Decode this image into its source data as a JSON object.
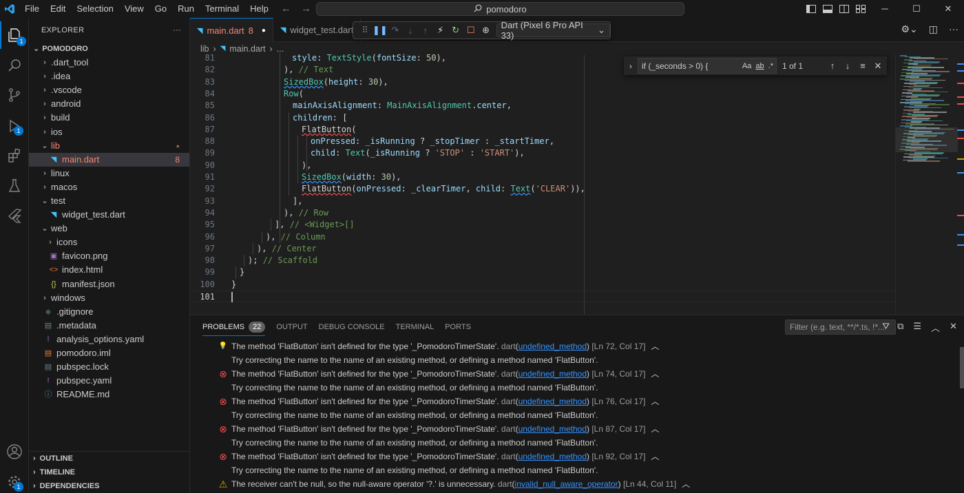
{
  "titlebar": {
    "menu": [
      "File",
      "Edit",
      "Selection",
      "View",
      "Go",
      "Run",
      "Terminal",
      "Help"
    ],
    "search": "pomodoro"
  },
  "activity": {
    "explorer_badge": "1",
    "debug_badge": "1",
    "settings_badge": "1"
  },
  "sidebar": {
    "title": "EXPLORER",
    "root": "POMODORO",
    "items": [
      {
        "label": ".dart_tool",
        "indent": 0,
        "kind": "folder",
        "open": false
      },
      {
        "label": ".idea",
        "indent": 0,
        "kind": "folder",
        "open": false
      },
      {
        "label": ".vscode",
        "indent": 0,
        "kind": "folder",
        "open": false
      },
      {
        "label": "android",
        "indent": 0,
        "kind": "folder",
        "open": false
      },
      {
        "label": "build",
        "indent": 0,
        "kind": "folder",
        "open": false
      },
      {
        "label": "ios",
        "indent": 0,
        "kind": "folder",
        "open": false
      },
      {
        "label": "lib",
        "indent": 0,
        "kind": "folder",
        "open": true,
        "error": true,
        "right": "●"
      },
      {
        "label": "main.dart",
        "indent": 1,
        "kind": "dart",
        "error": true,
        "selected": true,
        "right": "8"
      },
      {
        "label": "linux",
        "indent": 0,
        "kind": "folder",
        "open": false
      },
      {
        "label": "macos",
        "indent": 0,
        "kind": "folder",
        "open": false
      },
      {
        "label": "test",
        "indent": 0,
        "kind": "folder",
        "open": true
      },
      {
        "label": "widget_test.dart",
        "indent": 1,
        "kind": "dart"
      },
      {
        "label": "web",
        "indent": 0,
        "kind": "folder",
        "open": true
      },
      {
        "label": "icons",
        "indent": 1,
        "kind": "folder",
        "open": false
      },
      {
        "label": "favicon.png",
        "indent": 1,
        "kind": "image"
      },
      {
        "label": "index.html",
        "indent": 1,
        "kind": "html"
      },
      {
        "label": "manifest.json",
        "indent": 1,
        "kind": "json"
      },
      {
        "label": "windows",
        "indent": 0,
        "kind": "folder",
        "open": false
      },
      {
        "label": ".gitignore",
        "indent": 0,
        "kind": "git"
      },
      {
        "label": ".metadata",
        "indent": 0,
        "kind": "meta"
      },
      {
        "label": "analysis_options.yaml",
        "indent": 0,
        "kind": "yaml"
      },
      {
        "label": "pomodoro.iml",
        "indent": 0,
        "kind": "iml"
      },
      {
        "label": "pubspec.lock",
        "indent": 0,
        "kind": "lock"
      },
      {
        "label": "pubspec.yaml",
        "indent": 0,
        "kind": "yaml"
      },
      {
        "label": "README.md",
        "indent": 0,
        "kind": "info"
      }
    ],
    "sections": [
      "OUTLINE",
      "TIMELINE",
      "DEPENDENCIES"
    ]
  },
  "tabs": [
    {
      "label": "main.dart",
      "count": "8",
      "active": true
    },
    {
      "label": "widget_test.dart",
      "active": false
    }
  ],
  "debug": {
    "device": "Dart (Pixel 6 Pro API 33)"
  },
  "breadcrumb": [
    "lib",
    "main.dart",
    "..."
  ],
  "find": {
    "query": "if (_seconds > 0) {",
    "count": "1 of 1",
    "opt_case": "Aa",
    "opt_word": "ab",
    "opt_regex": ".*"
  },
  "code": [
    {
      "n": "81",
      "html": "<span class=\"p\">style</span><span class=\"d\">: </span><span class=\"t\">TextStyle</span><span class=\"d\">(</span><span class=\"p\">fontSize</span><span class=\"d\">: </span><span class=\"n\">50</span><span class=\"d\">),</span>",
      "indent": 88
    },
    {
      "n": "82",
      "html": "<span class=\"d\">), </span><span class=\"c\">// Text</span>",
      "indent": 76
    },
    {
      "n": "83",
      "html": "<span class=\"t info\">SizedBox</span><span class=\"d\">(</span><span class=\"p\">height</span><span class=\"d\">: </span><span class=\"n\">30</span><span class=\"d\">),</span>",
      "indent": 76
    },
    {
      "n": "84",
      "html": "<span class=\"t\">Row</span><span class=\"d\">(</span>",
      "indent": 76
    },
    {
      "n": "85",
      "html": "<span class=\"p\">mainAxisAlignment</span><span class=\"d\">: </span><span class=\"t\">MainAxisAlignment</span><span class=\"d\">.</span><span class=\"p\">center</span><span class=\"d\">,</span>",
      "indent": 89
    },
    {
      "n": "86",
      "html": "<span class=\"p\">children</span><span class=\"d\">: [</span>",
      "indent": 89
    },
    {
      "n": "87",
      "html": "<span class=\"d err\">FlatButton</span><span class=\"d\">(</span>",
      "indent": 102
    },
    {
      "n": "88",
      "html": "<span class=\"p\">onPressed</span><span class=\"d\">: </span><span class=\"p\">_isRunning</span><span class=\"d\"> ? </span><span class=\"p\">_stopTimer</span><span class=\"d\"> : </span><span class=\"p\">_startTimer</span><span class=\"d\">,</span>",
      "indent": 115
    },
    {
      "n": "89",
      "html": "<span class=\"p\">child</span><span class=\"d\">: </span><span class=\"t\">Text</span><span class=\"d\">(</span><span class=\"p\">_isRunning</span><span class=\"d\"> ? </span><span class=\"s\">'STOP'</span><span class=\"d\"> : </span><span class=\"s\">'START'</span><span class=\"d\">),</span>",
      "indent": 115
    },
    {
      "n": "90",
      "html": "<span class=\"d\">),</span>",
      "indent": 102
    },
    {
      "n": "91",
      "html": "<span class=\"t info\">SizedBox</span><span class=\"d\">(</span><span class=\"p\">width</span><span class=\"d\">: </span><span class=\"n\">30</span><span class=\"d\">),</span>",
      "indent": 102
    },
    {
      "n": "92",
      "html": "<span class=\"d err\">FlatButton</span><span class=\"d\">(</span><span class=\"p\">onPressed</span><span class=\"d\">: </span><span class=\"p\">_clearTimer</span><span class=\"d\">, </span><span class=\"p\">child</span><span class=\"d\">: </span><span class=\"t info\">Text</span><span class=\"d\">(</span><span class=\"s\">'CLEAR'</span><span class=\"d\">)),</span>",
      "indent": 102
    },
    {
      "n": "93",
      "html": "<span class=\"d\">],</span>",
      "indent": 89
    },
    {
      "n": "94",
      "html": "<span class=\"d\">), </span><span class=\"c\">// Row</span>",
      "indent": 76
    },
    {
      "n": "95",
      "html": "<span class=\"d\">], </span><span class=\"c\">// &lt;Widget&gt;[]</span>",
      "indent": 63
    },
    {
      "n": "96",
      "html": "<span class=\"d\">), </span><span class=\"c\">// Column</span>",
      "indent": 50
    },
    {
      "n": "97",
      "html": "<span class=\"d\">), </span><span class=\"c\">// Center</span>",
      "indent": 37
    },
    {
      "n": "98",
      "html": "<span class=\"d\">); </span><span class=\"c\">// Scaffold</span>",
      "indent": 24
    },
    {
      "n": "99",
      "html": "<span class=\"d\">}</span>",
      "indent": 12
    },
    {
      "n": "100",
      "html": "<span class=\"d\">}</span>",
      "indent": 0
    },
    {
      "n": "101",
      "html": "",
      "indent": 0,
      "current": true
    }
  ],
  "panel": {
    "tabs": [
      "PROBLEMS",
      "OUTPUT",
      "DEBUG CONSOLE",
      "TERMINAL",
      "PORTS"
    ],
    "problems_count": "22",
    "filter_placeholder": "Filter (e.g. text, **/*.ts, !*...",
    "rows": [
      {
        "icon": "bulb",
        "msg": "The method 'FlatButton' isn't defined for the type '_PomodoroTimerState'.",
        "src": "dart",
        "code": "undefined_method",
        "pos": "[Ln 72, Col 17]",
        "hint": "Try correcting the name to the name of an existing method, or defining a method named 'FlatButton'."
      },
      {
        "icon": "error",
        "msg": "The method 'FlatButton' isn't defined for the type '_PomodoroTimerState'.",
        "src": "dart",
        "code": "undefined_method",
        "pos": "[Ln 74, Col 17]",
        "hint": "Try correcting the name to the name of an existing method, or defining a method named 'FlatButton'."
      },
      {
        "icon": "error",
        "msg": "The method 'FlatButton' isn't defined for the type '_PomodoroTimerState'.",
        "src": "dart",
        "code": "undefined_method",
        "pos": "[Ln 76, Col 17]",
        "hint": "Try correcting the name to the name of an existing method, or defining a method named 'FlatButton'."
      },
      {
        "icon": "error",
        "msg": "The method 'FlatButton' isn't defined for the type '_PomodoroTimerState'.",
        "src": "dart",
        "code": "undefined_method",
        "pos": "[Ln 87, Col 17]",
        "hint": "Try correcting the name to the name of an existing method, or defining a method named 'FlatButton'."
      },
      {
        "icon": "error",
        "msg": "The method 'FlatButton' isn't defined for the type '_PomodoroTimerState'.",
        "src": "dart",
        "code": "undefined_method",
        "pos": "[Ln 92, Col 17]",
        "hint": "Try correcting the name to the name of an existing method, or defining a method named 'FlatButton'."
      },
      {
        "icon": "warning",
        "msg": "The receiver can't be null, so the null-aware operator '?.' is unnecessary.",
        "src": "dart",
        "code": "invalid_null_aware_operator",
        "pos": "[Ln 44, Col 11]",
        "hint": ""
      }
    ]
  },
  "colors": {
    "accent": "#0078d4",
    "error": "#f14c4c",
    "warning": "#cca700",
    "bg": "#1f1f1f"
  }
}
